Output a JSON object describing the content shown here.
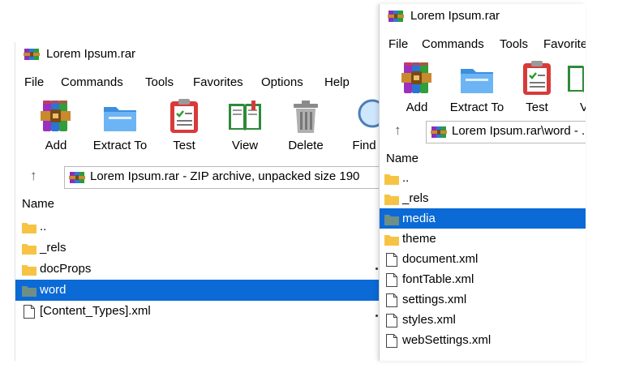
{
  "window1": {
    "title": "Lorem Ipsum.rar",
    "menu": [
      "File",
      "Commands",
      "Tools",
      "Favorites",
      "Options",
      "Help"
    ],
    "toolbar": [
      {
        "label": "Add",
        "icon": "add-archive-icon"
      },
      {
        "label": "Extract To",
        "icon": "extract-folder-icon"
      },
      {
        "label": "Test",
        "icon": "test-clipboard-icon"
      },
      {
        "label": "View",
        "icon": "view-book-icon"
      },
      {
        "label": "Delete",
        "icon": "trash-icon"
      },
      {
        "label": "Find",
        "icon": "magnifier-icon"
      }
    ],
    "path": "Lorem Ipsum.rar - ZIP archive, unpacked size 190",
    "column_header": "Name",
    "files": [
      {
        "name": "..",
        "type": "folder-up"
      },
      {
        "name": "_rels",
        "type": "folder"
      },
      {
        "name": "docProps",
        "type": "folder"
      },
      {
        "name": "word",
        "type": "folder",
        "selected": true
      },
      {
        "name": "[Content_Types].xml",
        "type": "file"
      }
    ]
  },
  "window2": {
    "title": "Lorem Ipsum.rar",
    "menu": [
      "File",
      "Commands",
      "Tools",
      "Favorite"
    ],
    "toolbar": [
      {
        "label": "Add",
        "icon": "add-archive-icon"
      },
      {
        "label": "Extract To",
        "icon": "extract-folder-icon"
      },
      {
        "label": "Test",
        "icon": "test-clipboard-icon"
      },
      {
        "label": "V",
        "icon": "view-book-icon"
      }
    ],
    "path": "Lorem Ipsum.rar\\word - ...",
    "column_header": "Name",
    "files": [
      {
        "name": "..",
        "type": "folder-up"
      },
      {
        "name": "_rels",
        "type": "folder"
      },
      {
        "name": "media",
        "type": "folder",
        "selected": true
      },
      {
        "name": "theme",
        "type": "folder"
      },
      {
        "name": "document.xml",
        "type": "file"
      },
      {
        "name": "fontTable.xml",
        "type": "file"
      },
      {
        "name": "settings.xml",
        "type": "file"
      },
      {
        "name": "styles.xml",
        "type": "file"
      },
      {
        "name": "webSettings.xml",
        "type": "file"
      }
    ]
  },
  "colors": {
    "selection": "#0b6ad6",
    "folder": "#f6c344",
    "folder_selected": "#6f8f86"
  }
}
